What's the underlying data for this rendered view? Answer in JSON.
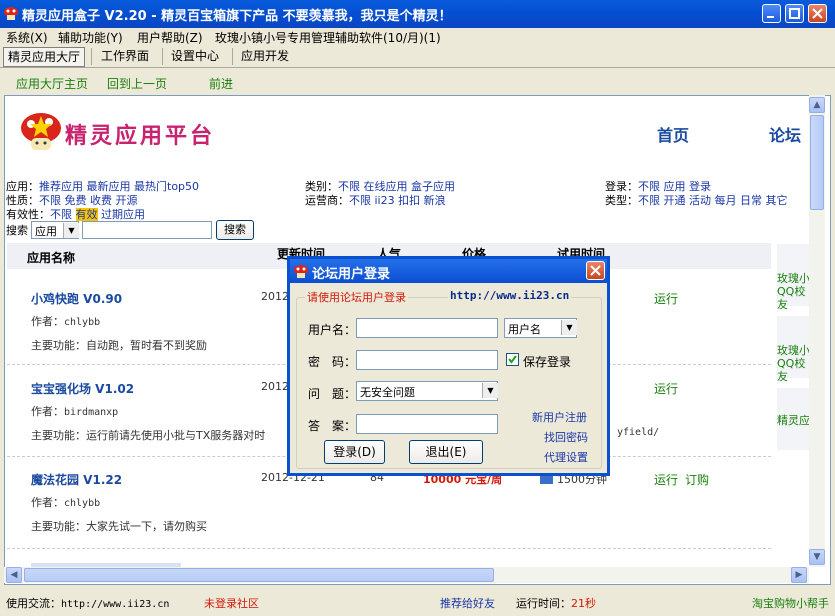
{
  "window": {
    "title": "精灵应用盒子 V2.20 - 精灵百宝箱旗下产品 不要羡慕我，我只是个精灵！"
  },
  "menubar": {
    "items": [
      "系统(X)",
      "辅助功能(Y)",
      "用户帮助(Z)",
      "玫瑰小镇小号专用管理辅助软件(10/月)(1)"
    ]
  },
  "tabs": [
    "精灵应用大厅",
    "工作界面",
    "设置中心",
    "应用开发"
  ],
  "nav": {
    "home": "应用大厅主页",
    "back": "回到上一页",
    "forward": "前进"
  },
  "site": {
    "logo_text": "精灵应用平台",
    "nav_home": "首页",
    "nav_forum": "论坛"
  },
  "filters": {
    "app_label": "应用：",
    "app_items": [
      "推荐应用",
      "最新应用",
      "最热门top50"
    ],
    "category_label": "类别：",
    "category_items": [
      "不限",
      "在线应用",
      "盒子应用"
    ],
    "login_label": "登录：",
    "login_items": [
      "不限",
      "应用",
      "登录"
    ],
    "nature_label": "性质：",
    "nature_items": [
      "不限",
      "免费",
      "收费",
      "开源"
    ],
    "operator_label": "运营商：",
    "operator_items": [
      "不限",
      "ii23",
      "扣扣",
      "新浪"
    ],
    "type_label": "类型：",
    "type_items": [
      "不限",
      "开通",
      "活动",
      "每月",
      "日常",
      "其它"
    ],
    "validity_label": "有效性：",
    "validity_items": [
      "不限",
      "有效",
      "过期应用"
    ],
    "search_label": "搜索",
    "search_select": "应用",
    "search_button": "搜索"
  },
  "table": {
    "headers": [
      "应用名称",
      "更新时间",
      "人气",
      "价格",
      "试用时间"
    ],
    "rows": [
      {
        "name": "小鸡快跑 V0.90",
        "author_label": "作者：",
        "author": "chlybb",
        "desc_label": "主要功能：",
        "desc": "自动跑，暂时看不到奖励",
        "date": "2012-",
        "actions": [
          "运行"
        ]
      },
      {
        "name": "宝宝强化场 V1.02",
        "author_label": "作者：",
        "author": "birdmanxp",
        "desc_label": "主要功能：",
        "desc": "运行前请先使用小批与TX服务器对时",
        "date": "2012-",
        "extra": "yfield/",
        "actions": [
          "运行"
        ]
      },
      {
        "name": "魔法花园 V1.22",
        "author_label": "作者：",
        "author": "chlybb",
        "desc_label": "主要功能：",
        "desc": "大家先试一下，请勿购买",
        "date": "2012-12-21",
        "popularity": "84",
        "price": "10000 元宝/周",
        "trial": "1500分钟",
        "actions": [
          "运行",
          "订购"
        ]
      }
    ]
  },
  "side_ads": [
    "玫瑰小QQ校友",
    "玫瑰小QQ校友",
    "精灵应"
  ],
  "dialog": {
    "title": "论坛用户登录",
    "group_label": "请使用论坛用户登录",
    "url": "http://www.ii23.cn",
    "username_label": "用户名：",
    "username_type": "用户名",
    "password_label": "密　码：",
    "save_login": "保存登录",
    "question_label": "问　题：",
    "question_value": "无安全问题",
    "answer_label": "答　案：",
    "register": "新用户注册",
    "recover": "找回密码",
    "proxy": "代理设置",
    "login_button": "登录(D)",
    "exit_button": "退出(E)"
  },
  "statusbar": {
    "contact_label": "使用交流：",
    "contact_url": "http://www.ii23.cn",
    "not_logged": "未登录社区",
    "recommend": "推荐给好友",
    "runtime_label": "运行时间：",
    "runtime_value": "21秒",
    "taobao": "淘宝购物小帮手"
  },
  "colors": {
    "title_blue": "#0a51cf",
    "link_green": "#1a7f0e",
    "link_blue": "#1a36a6",
    "red": "#d21a0a"
  }
}
